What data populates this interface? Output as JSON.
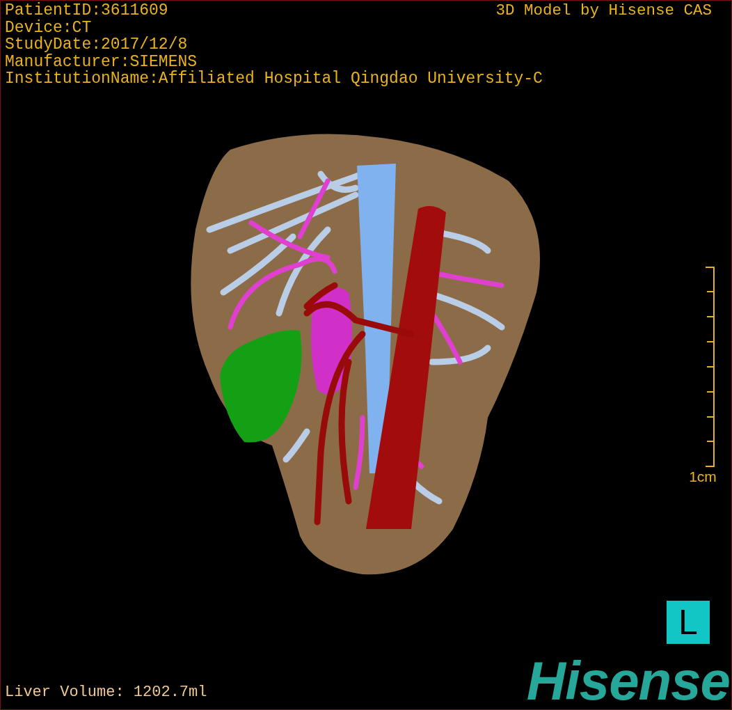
{
  "patient_info": [
    "PatientID:3611609",
    "Device:CT",
    "StudyDate:2017/12/8",
    "Manufacturer:SIEMENS",
    "InstitutionName:Affiliated Hospital Qingdao University-C"
  ],
  "title": "3D Model by Hisense CAS",
  "scale_bar": {
    "label": "1cm"
  },
  "orientation_marker": "L",
  "measurement": "Liver Volume: 1202.7ml",
  "logo": "Hisense"
}
